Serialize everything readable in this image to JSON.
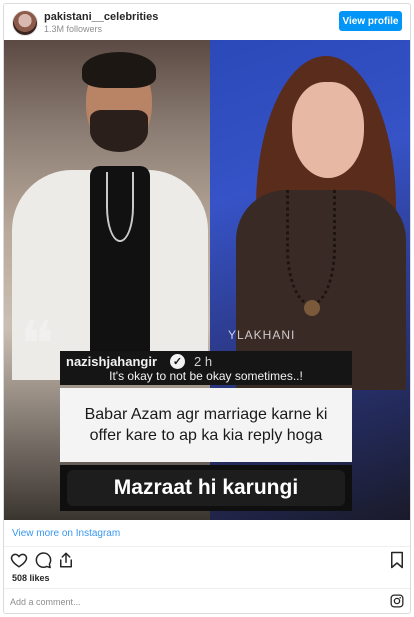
{
  "header": {
    "account_name": "pakistani__celebrities",
    "followers": "1.3M followers",
    "view_profile_label": "View profile"
  },
  "media": {
    "watermark": "YLAKHANI",
    "story_username": "nazishjahangir",
    "story_time": "2 h",
    "story_caption": "It's okay to not be okay sometimes..!",
    "question": "Babar  Azam agr marriage karne ki offer kare to ap ka kia reply hoga",
    "answer": "Mazraat hi karungi"
  },
  "footer": {
    "view_more": "View more on Instagram",
    "likes": "508 likes",
    "comment_placeholder": "Add a comment..."
  },
  "icons": [
    "heart-icon",
    "comment-icon",
    "share-icon",
    "bookmark-icon",
    "instagram-icon",
    "verified-icon"
  ],
  "colors": {
    "accent_blue": "#0095f6",
    "link_blue": "#3897f0",
    "border": "#dbdbdb"
  }
}
